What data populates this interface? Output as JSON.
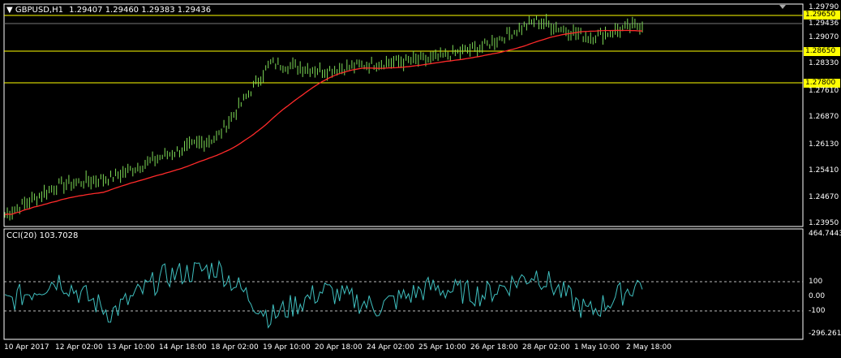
{
  "header": {
    "menu_icon": "triangle-down-icon",
    "symbol_title": "GBPUSD,H1",
    "ohlc": "1.29407 1.29460 1.29383 1.29436"
  },
  "indicator_header": {
    "label": "CCI(20) 103.7028"
  },
  "price_axis": {
    "labels": [
      "1.29790",
      "1.29436",
      "1.29070",
      "1.28330",
      "1.27610",
      "1.26870",
      "1.26130",
      "1.25410",
      "1.24670",
      "1.23950"
    ],
    "tags": [
      "1.29650",
      "1.28650",
      "1.27800"
    ]
  },
  "cci_axis": {
    "labels": [
      "464.7443",
      "100",
      "0.00",
      "-100",
      "-296.2614"
    ]
  },
  "time_axis": {
    "labels": [
      "10 Apr 2017",
      "12 Apr 02:00",
      "13 Apr 10:00",
      "14 Apr 18:00",
      "18 Apr 02:00",
      "19 Apr 10:00",
      "20 Apr 18:00",
      "24 Apr 02:00",
      "25 Apr 10:00",
      "26 Apr 18:00",
      "28 Apr 02:00",
      "1 May 10:00",
      "2 May 18:00"
    ]
  },
  "colors": {
    "background": "#000000",
    "candles": "#7fdc57",
    "moving_average": "#ff2a2a",
    "cci_line": "#3fbfbf",
    "horizontal_levels": "#ffff00",
    "grid_frame": "#ffffff"
  },
  "chart_data": [
    {
      "type": "line",
      "title": "GBPUSD,H1",
      "xlabel": "",
      "ylabel": "",
      "ylim": [
        1.2395,
        1.2979
      ],
      "x": [
        "10 Apr 2017",
        "12 Apr 02:00",
        "13 Apr 10:00",
        "14 Apr 18:00",
        "18 Apr 02:00",
        "19 Apr 10:00",
        "20 Apr 18:00",
        "24 Apr 02:00",
        "25 Apr 10:00",
        "26 Apr 18:00",
        "28 Apr 02:00",
        "1 May 10:00",
        "2 May 18:00"
      ],
      "series": [
        {
          "name": "",
          "values": [
            1.242,
            1.25,
            1.252,
            1.258,
            1.263,
            1.283,
            1.281,
            1.283,
            1.284,
            1.2875,
            1.2945,
            1.29,
            1.2935
          ]
        }
      ],
      "levels": [
        1.2965,
        1.2865,
        1.278
      ]
    },
    {
      "type": "line",
      "title": "CCI(20) 103.7028",
      "ylim": [
        -296.2614,
        464.7443
      ],
      "levels": [
        100,
        -100
      ],
      "x": [
        "10 Apr 2017",
        "12 Apr 02:00",
        "13 Apr 10:00",
        "14 Apr 18:00",
        "18 Apr 02:00",
        "19 Apr 10:00",
        "20 Apr 18:00",
        "24 Apr 02:00",
        "25 Apr 10:00",
        "26 Apr 18:00",
        "28 Apr 02:00",
        "1 May 10:00",
        "2 May 18:00"
      ],
      "series": [
        {
          "name": "",
          "values": [
            -50,
            120,
            -120,
            140,
            200,
            -150,
            40,
            -80,
            60,
            10,
            160,
            -120,
            103.7
          ]
        }
      ]
    }
  ]
}
